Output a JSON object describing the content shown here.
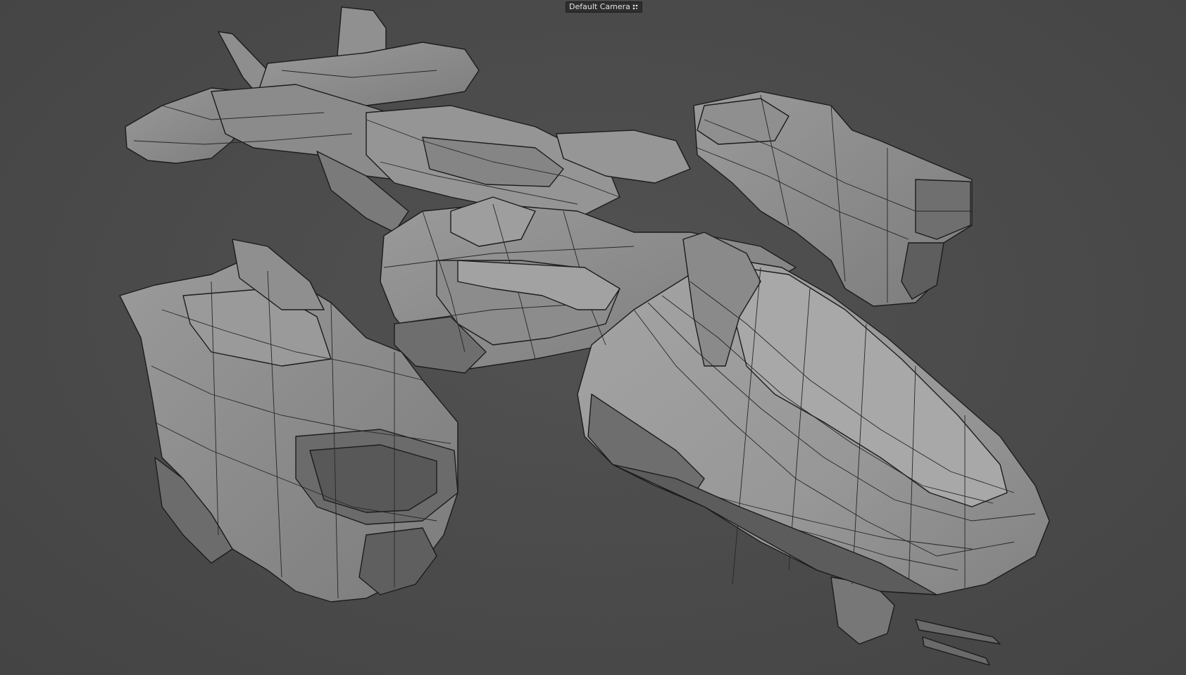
{
  "viewport": {
    "camera_label": "Default Camera",
    "camera_icon": "camera-dots-icon",
    "background_color": "#4a4a4a",
    "model_shade_color": "#8a8a8a",
    "wireframe_color": "#1c1c1c"
  }
}
